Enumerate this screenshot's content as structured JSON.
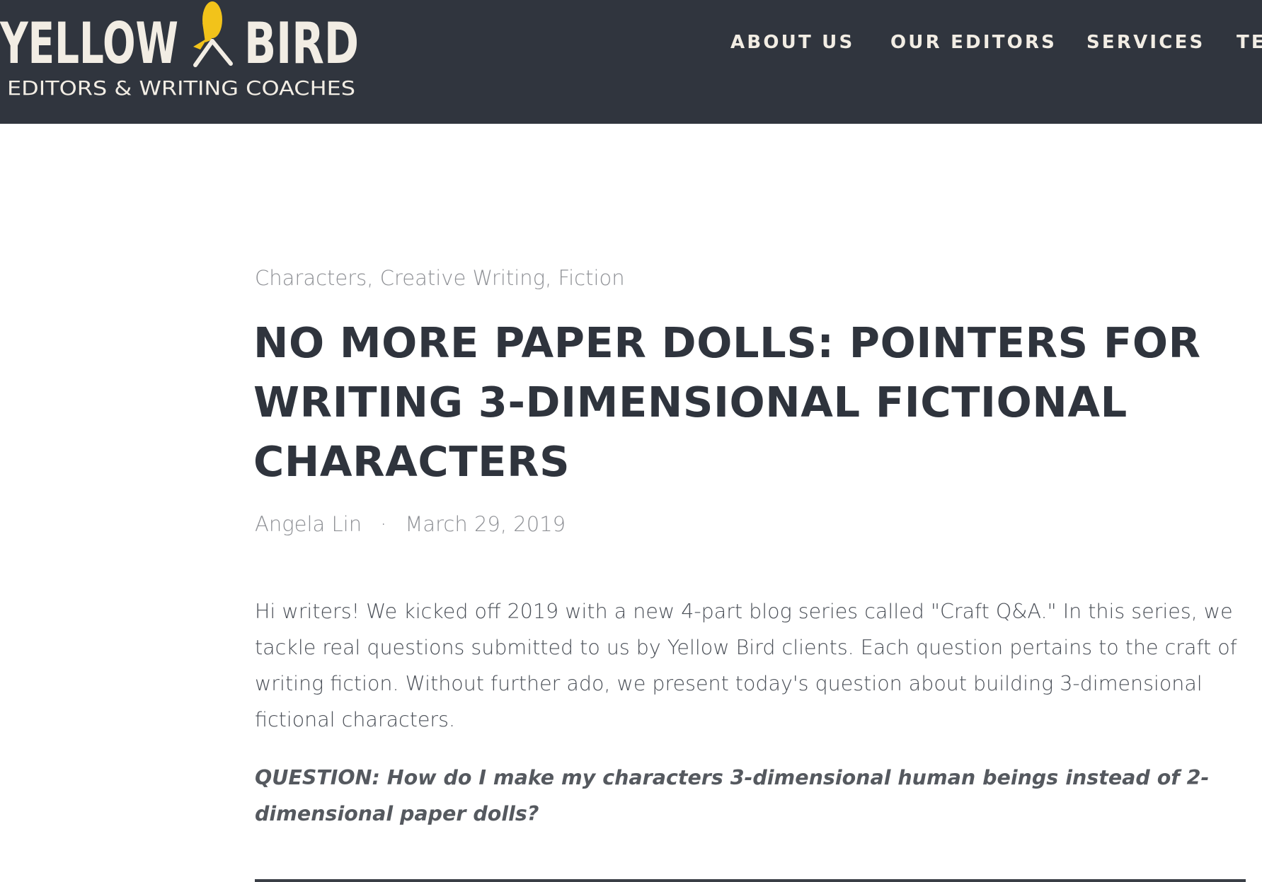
{
  "header": {
    "logo": {
      "name": "YELLOW",
      "name2": "BIRD",
      "tagline": "EDITORS & WRITING COACHES",
      "bird_color": "#f2c31a"
    },
    "nav": [
      "ABOUT US",
      "OUR EDITORS",
      "SERVICES",
      "TE"
    ],
    "background": "#30353e"
  },
  "post": {
    "categories": [
      "Characters",
      "Creative Writing",
      "Fiction"
    ],
    "title": "NO MORE PAPER DOLLS: POINTERS FOR WRITING 3-DIMENSIONAL FICTIONAL CHARACTERS",
    "author": "Angela Lin",
    "separator": "·",
    "date": "March 29, 2019",
    "intro": "Hi writers! We kicked off 2019 with a new 4-part blog series called \"Craft Q&A.\" In this series, we tackle real questions submitted to us by Yellow Bird clients. Each question pertains to the craft of writing fiction. Without further ado, we present today's question about building 3-dimensional fictional characters.",
    "question": "QUESTION: How do I make my characters 3-dimensional human beings instead of 2-dimensional paper dolls?"
  }
}
